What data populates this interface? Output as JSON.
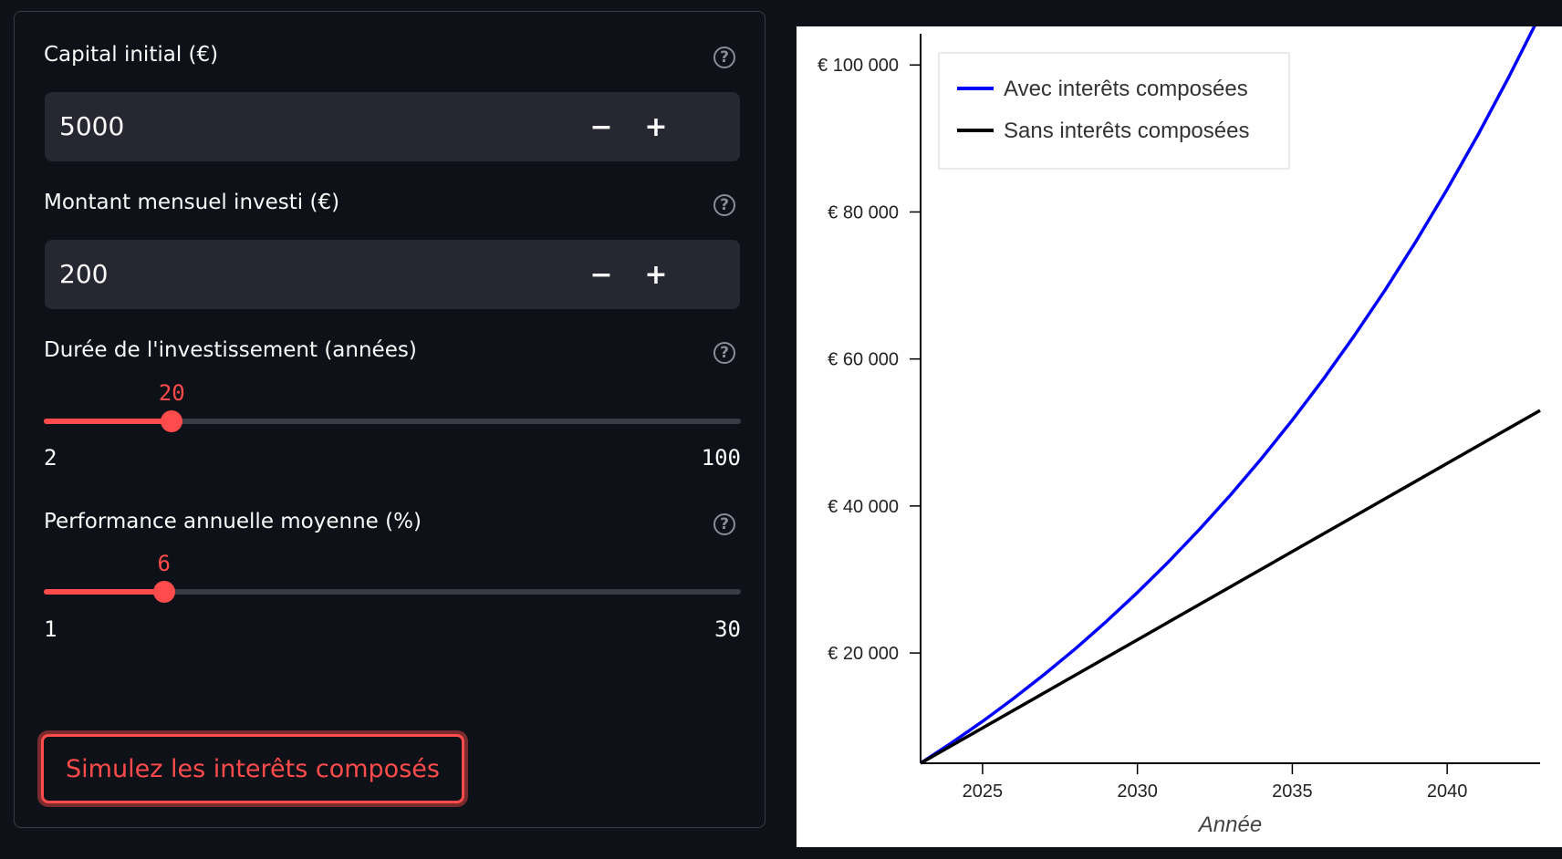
{
  "form": {
    "capital": {
      "label": "Capital initial (€)",
      "value": "5000",
      "minus": "−",
      "plus": "+"
    },
    "monthly": {
      "label": "Montant mensuel investi (€)",
      "value": "200",
      "minus": "−",
      "plus": "+"
    },
    "duration": {
      "label": "Durée de l'investissement (années)",
      "value": 20,
      "min": 2,
      "max": 100
    },
    "performance": {
      "label": "Performance annuelle moyenne (%)",
      "value": 6,
      "min": 1,
      "max": 30
    },
    "help_glyph": "?",
    "submit_label": "Simulez les interêts composés"
  },
  "theme": {
    "accent": "#ff4b4b",
    "background": "#0e1117",
    "input_bg": "#262730"
  },
  "chart_data": {
    "type": "line",
    "xlabel": "Année",
    "ylabel": "",
    "xlim": [
      2023,
      2043
    ],
    "ylim": [
      5000,
      104000
    ],
    "x_ticks": [
      2025,
      2030,
      2035,
      2040
    ],
    "y_ticks": [
      20000,
      40000,
      60000,
      80000,
      100000
    ],
    "y_tick_labels": [
      "€ 20 000",
      "€ 40 000",
      "€ 60 000",
      "€ 80 000",
      "€ 100 000"
    ],
    "legend_position": "top-left",
    "grid": false,
    "series": [
      {
        "name": "Avec interêts composées",
        "color": "#0000ff",
        "x": [
          2023,
          2024,
          2025,
          2026,
          2027,
          2028,
          2029,
          2030,
          2031,
          2032,
          2033,
          2034,
          2035,
          2036,
          2037,
          2038,
          2039,
          2040,
          2041,
          2042,
          2043
        ],
        "y": [
          5000,
          7767,
          10700,
          13810,
          17106,
          20600,
          24304,
          28230,
          32392,
          36803,
          41479,
          46435,
          51689,
          57258,
          63161,
          69418,
          76051,
          83082,
          90535,
          98435,
          106809
        ]
      },
      {
        "name": "Sans interêts composées",
        "color": "#000000",
        "x": [
          2023,
          2043
        ],
        "y": [
          5000,
          53000
        ]
      }
    ]
  }
}
